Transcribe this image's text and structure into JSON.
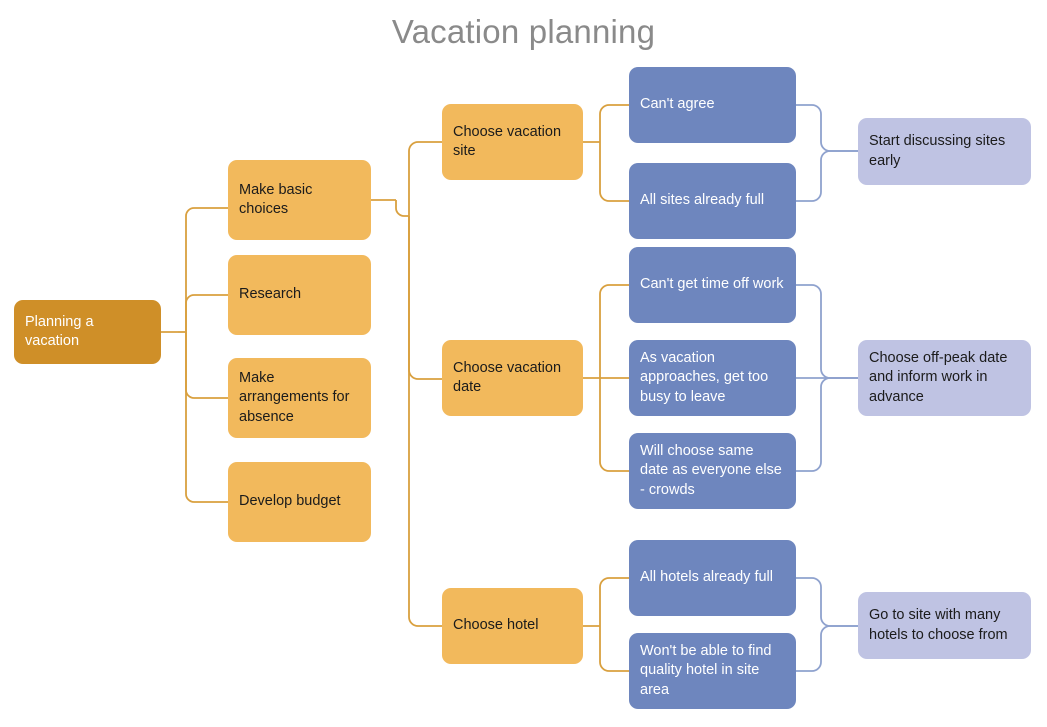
{
  "diagram": {
    "title": "Vacation planning",
    "type": "tree-mind-map",
    "colors": {
      "root_fill": "#cf8f28",
      "branch_fill": "#f2b95c",
      "issue_fill": "#6e86be",
      "solution_fill": "#bfc3e3",
      "orange_connector": "#d9a03f",
      "blue_connector": "#8fa2ce",
      "title_text": "#8a8a8a"
    },
    "nodes": {
      "root": {
        "label": "Planning a vacation"
      },
      "level1": [
        {
          "label": "Make basic choices"
        },
        {
          "label": "Research"
        },
        {
          "label": "Make arrangements for absence"
        },
        {
          "label": "Develop budget"
        }
      ],
      "level2": [
        {
          "label": "Choose vacation site"
        },
        {
          "label": "Choose vacation date"
        },
        {
          "label": "Choose hotel"
        }
      ],
      "issues": [
        {
          "label": "Can't agree"
        },
        {
          "label": "All sites already full"
        },
        {
          "label": "Can't get time off work"
        },
        {
          "label": "As vacation approaches, get too busy to leave"
        },
        {
          "label": "Will choose same date as everyone else - crowds"
        },
        {
          "label": "All hotels already full"
        },
        {
          "label": "Won't be able to find quality hotel in site area"
        }
      ],
      "solutions": [
        {
          "label": "Start discussing sites early"
        },
        {
          "label": "Choose off-peak date and inform work in advance"
        },
        {
          "label": "Go to site with many hotels to choose from"
        }
      ]
    }
  }
}
